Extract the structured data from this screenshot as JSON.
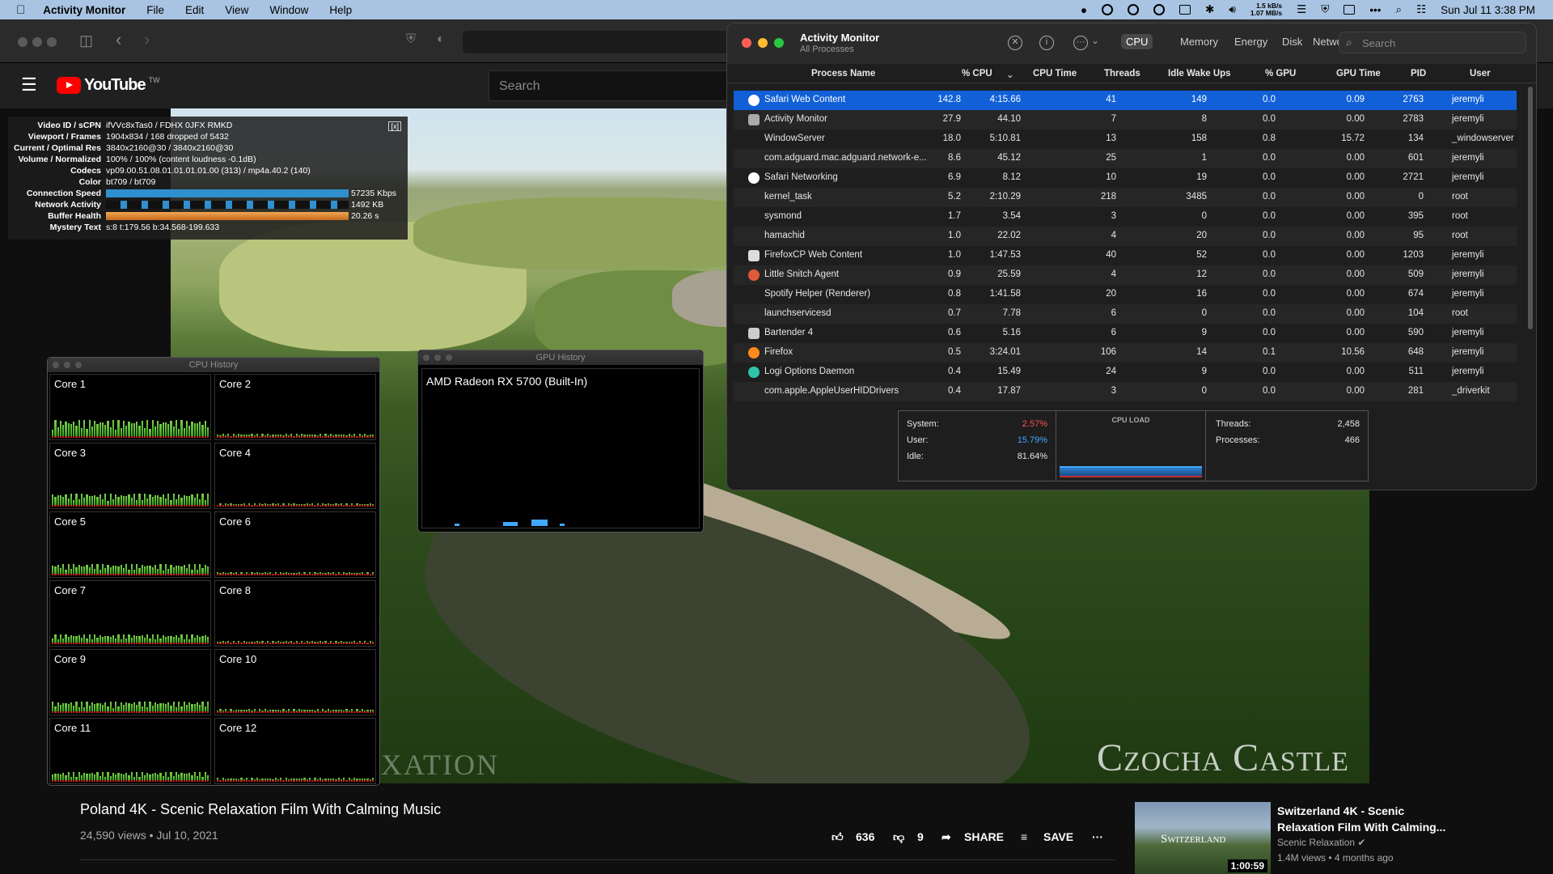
{
  "menubar": {
    "app": "Activity Monitor",
    "items": [
      "File",
      "Edit",
      "View",
      "Window",
      "Help"
    ],
    "net_up": "1.5 kB/s",
    "net_down": "1.07 MB/s",
    "datetime": "Sun Jul 11  3:38 PM"
  },
  "youtube": {
    "logo": "YouTube",
    "region": "TW",
    "search_placeholder": "Search"
  },
  "nerds": {
    "close": "[x]",
    "rows": [
      {
        "label": "Video ID / sCPN",
        "value": "ifVVc8xTas0 / FDHX 0JFX RMKD"
      },
      {
        "label": "Viewport / Frames",
        "value": "1904x834 / 168 dropped of 5432"
      },
      {
        "label": "Current / Optimal Res",
        "value": "3840x2160@30 / 3840x2160@30"
      },
      {
        "label": "Volume / Normalized",
        "value": "100% / 100% (content loudness -0.1dB)"
      },
      {
        "label": "Codecs",
        "value": "vp09.00.51.08.01.01.01.01.00 (313) / mp4a.40.2 (140)"
      },
      {
        "label": "Color",
        "value": "bt709 / bt709"
      },
      {
        "label": "Connection Speed",
        "value": "57235 Kbps"
      },
      {
        "label": "Network Activity",
        "value": "1492 KB"
      },
      {
        "label": "Buffer Health",
        "value": "20.26 s"
      },
      {
        "label": "Mystery Text",
        "value": "s:8 t:179.56 b:34.568-199.633"
      }
    ]
  },
  "video": {
    "watermark": "Czocha Castle",
    "watermark_left": "XATION"
  },
  "cpu_history": {
    "title": "CPU History",
    "cores": [
      "Core 1",
      "Core 2",
      "Core 3",
      "Core 4",
      "Core 5",
      "Core 6",
      "Core 7",
      "Core 8",
      "Core 9",
      "Core 10",
      "Core 11",
      "Core 12"
    ]
  },
  "gpu_history": {
    "title": "GPU History",
    "gpu": "AMD Radeon RX 5700 (Built-In)"
  },
  "am": {
    "title": "Activity Monitor",
    "subtitle": "All Processes",
    "tabs": [
      "CPU",
      "Memory",
      "Energy",
      "Disk",
      "Network"
    ],
    "search_placeholder": "Search",
    "columns": [
      "Process Name",
      "% CPU",
      "CPU Time",
      "Threads",
      "Idle Wake Ups",
      "% GPU",
      "GPU Time",
      "PID",
      "User"
    ],
    "rows": [
      [
        "Safari Web Content",
        "142.8",
        "4:15.66",
        "41",
        "149",
        "0.0",
        "0.09",
        "2763",
        "jeremyli"
      ],
      [
        "Activity Monitor",
        "27.9",
        "44.10",
        "7",
        "8",
        "0.0",
        "0.00",
        "2783",
        "jeremyli"
      ],
      [
        "WindowServer",
        "18.0",
        "5:10.81",
        "13",
        "158",
        "0.8",
        "15.72",
        "134",
        "_windowserver"
      ],
      [
        "com.adguard.mac.adguard.network-e...",
        "8.6",
        "45.12",
        "25",
        "1",
        "0.0",
        "0.00",
        "601",
        "jeremyli"
      ],
      [
        "Safari Networking",
        "6.9",
        "8.12",
        "10",
        "19",
        "0.0",
        "0.00",
        "2721",
        "jeremyli"
      ],
      [
        "kernel_task",
        "5.2",
        "2:10.29",
        "218",
        "3485",
        "0.0",
        "0.00",
        "0",
        "root"
      ],
      [
        "sysmond",
        "1.7",
        "3.54",
        "3",
        "0",
        "0.0",
        "0.00",
        "395",
        "root"
      ],
      [
        "hamachid",
        "1.0",
        "22.02",
        "4",
        "20",
        "0.0",
        "0.00",
        "95",
        "root"
      ],
      [
        "FirefoxCP Web Content",
        "1.0",
        "1:47.53",
        "40",
        "52",
        "0.0",
        "0.00",
        "1203",
        "jeremyli"
      ],
      [
        "Little Snitch Agent",
        "0.9",
        "25.59",
        "4",
        "12",
        "0.0",
        "0.00",
        "509",
        "jeremyli"
      ],
      [
        "Spotify Helper (Renderer)",
        "0.8",
        "1:41.58",
        "20",
        "16",
        "0.0",
        "0.00",
        "674",
        "jeremyli"
      ],
      [
        "launchservicesd",
        "0.7",
        "7.78",
        "6",
        "0",
        "0.0",
        "0.00",
        "104",
        "root"
      ],
      [
        "Bartender 4",
        "0.6",
        "5.16",
        "6",
        "9",
        "0.0",
        "0.00",
        "590",
        "jeremyli"
      ],
      [
        "Firefox",
        "0.5",
        "3:24.01",
        "106",
        "14",
        "0.1",
        "10.56",
        "648",
        "jeremyli"
      ],
      [
        "Logi Options Daemon",
        "0.4",
        "15.49",
        "24",
        "9",
        "0.0",
        "0.00",
        "511",
        "jeremyli"
      ],
      [
        "com.apple.AppleUserHIDDrivers",
        "0.4",
        "17.87",
        "3",
        "0",
        "0.0",
        "0.00",
        "281",
        "_driverkit"
      ]
    ],
    "summary": {
      "system_label": "System:",
      "system": "2.57%",
      "user_label": "User:",
      "user": "15.79%",
      "idle_label": "Idle:",
      "idle": "81.64%",
      "load_label": "CPU LOAD",
      "threads_label": "Threads:",
      "threads": "2,458",
      "processes_label": "Processes:",
      "processes": "466"
    }
  },
  "below": {
    "title": "Poland 4K - Scenic Relaxation Film With Calming Music",
    "meta": "24,590 views • Jul 10, 2021",
    "likes": "636",
    "dislikes": "9",
    "share": "SHARE",
    "save": "SAVE",
    "rec_title": "Switzerland 4K - Scenic Relaxation Film With Calming...",
    "rec_channel": "Scenic Relaxation",
    "rec_meta": "1.4M views • 4 months ago",
    "rec_duration": "1:00:59",
    "rec_thumb_text": "Switzerland"
  },
  "colors": {
    "selection": "#1160d8",
    "system": "#ff4f4f",
    "user": "#41a8ff",
    "bar_green": "#7bd04a"
  }
}
